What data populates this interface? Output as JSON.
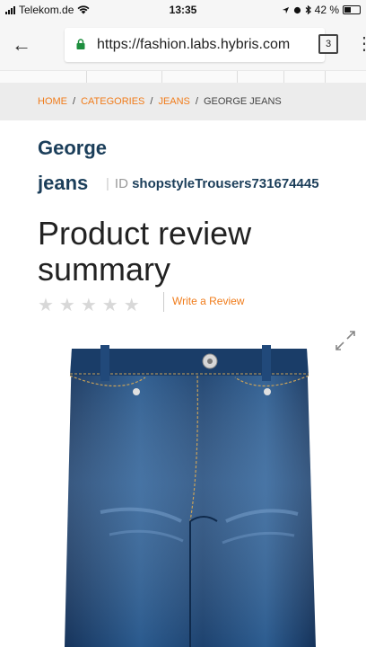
{
  "status_bar": {
    "carrier": "Telekom.de",
    "time": "13:35",
    "battery": "42 %"
  },
  "browser": {
    "url": "https://fashion.labs.hybris.com",
    "tab_count": "3"
  },
  "breadcrumb": {
    "items": [
      "HOME",
      "CATEGORIES",
      "JEANS"
    ],
    "separator": "/",
    "current": "GEORGE JEANS"
  },
  "product": {
    "name_line1": "George",
    "name_line2": "jeans",
    "id_label": "ID",
    "id_value": "shopstyleTrousers731674445",
    "review_title": "Product review summary",
    "stars": "★★★★★",
    "rating": 0,
    "rating_max": 5,
    "write_review": "Write a Review"
  },
  "colors": {
    "accent": "#f07c1b",
    "title": "#1b3e5a",
    "denim": "#1f3f6e"
  }
}
